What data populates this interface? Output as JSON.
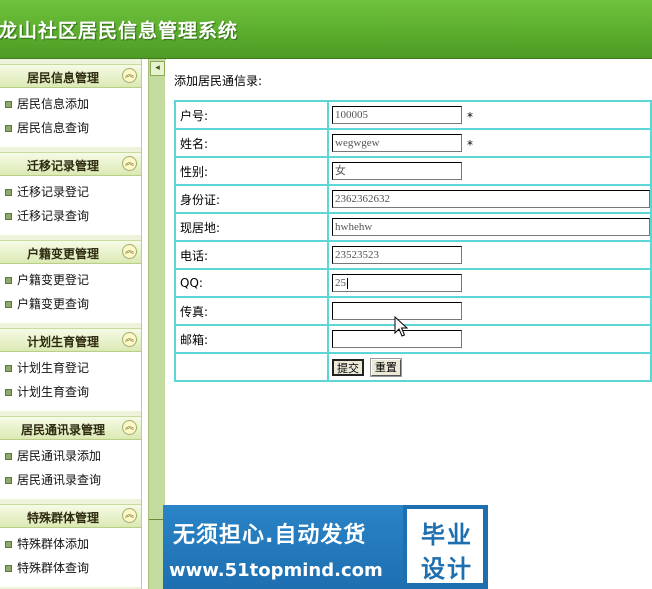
{
  "header": {
    "title": "龙山社区居民信息管理系统"
  },
  "sidebar": {
    "sections": [
      {
        "title": "居民信息管理",
        "items": [
          "居民信息添加",
          "居民信息查询"
        ]
      },
      {
        "title": "迁移记录管理",
        "items": [
          "迁移记录登记",
          "迁移记录查询"
        ]
      },
      {
        "title": "户籍变更管理",
        "items": [
          "户籍变更登记",
          "户籍变更查询"
        ]
      },
      {
        "title": "计划生育管理",
        "items": [
          "计划生育登记",
          "计划生育查询"
        ]
      },
      {
        "title": "居民通讯录管理",
        "items": [
          "居民通讯录添加",
          "居民通讯录查询"
        ]
      },
      {
        "title": "特殊群体管理",
        "items": [
          "特殊群体添加",
          "特殊群体查询"
        ]
      }
    ],
    "toggle_glyph": "︽"
  },
  "splitter": {
    "toggle_glyph": "◂"
  },
  "main": {
    "heading": "添加居民通信录:",
    "required_mark": "*",
    "fields": {
      "huhao": {
        "label": "户号:",
        "value": "100005"
      },
      "name": {
        "label": "姓名:",
        "value": "wegwgew"
      },
      "gender": {
        "label": "性别:",
        "value": "女"
      },
      "idcard": {
        "label": "身份证:",
        "value": "2362362632"
      },
      "address": {
        "label": "现居地:",
        "value": "hwhehw"
      },
      "phone": {
        "label": "电话:",
        "value": "23523523"
      },
      "qq": {
        "label": "QQ:",
        "value": "25"
      },
      "fax": {
        "label": "传真:",
        "value": ""
      },
      "email": {
        "label": "邮箱:",
        "value": ""
      }
    },
    "buttons": {
      "submit": "提交",
      "reset": "重置"
    }
  },
  "ad": {
    "line1": "无须担心.自动发货",
    "line2": "www.51topmind.com",
    "badge_line1": "毕业",
    "badge_line2": "设计"
  },
  "colors": {
    "banner": "#5cae2e",
    "table_border": "#5ed6d6",
    "sidebar_bg": "#eef4dc",
    "ad_blue": "#1d6fb0"
  }
}
